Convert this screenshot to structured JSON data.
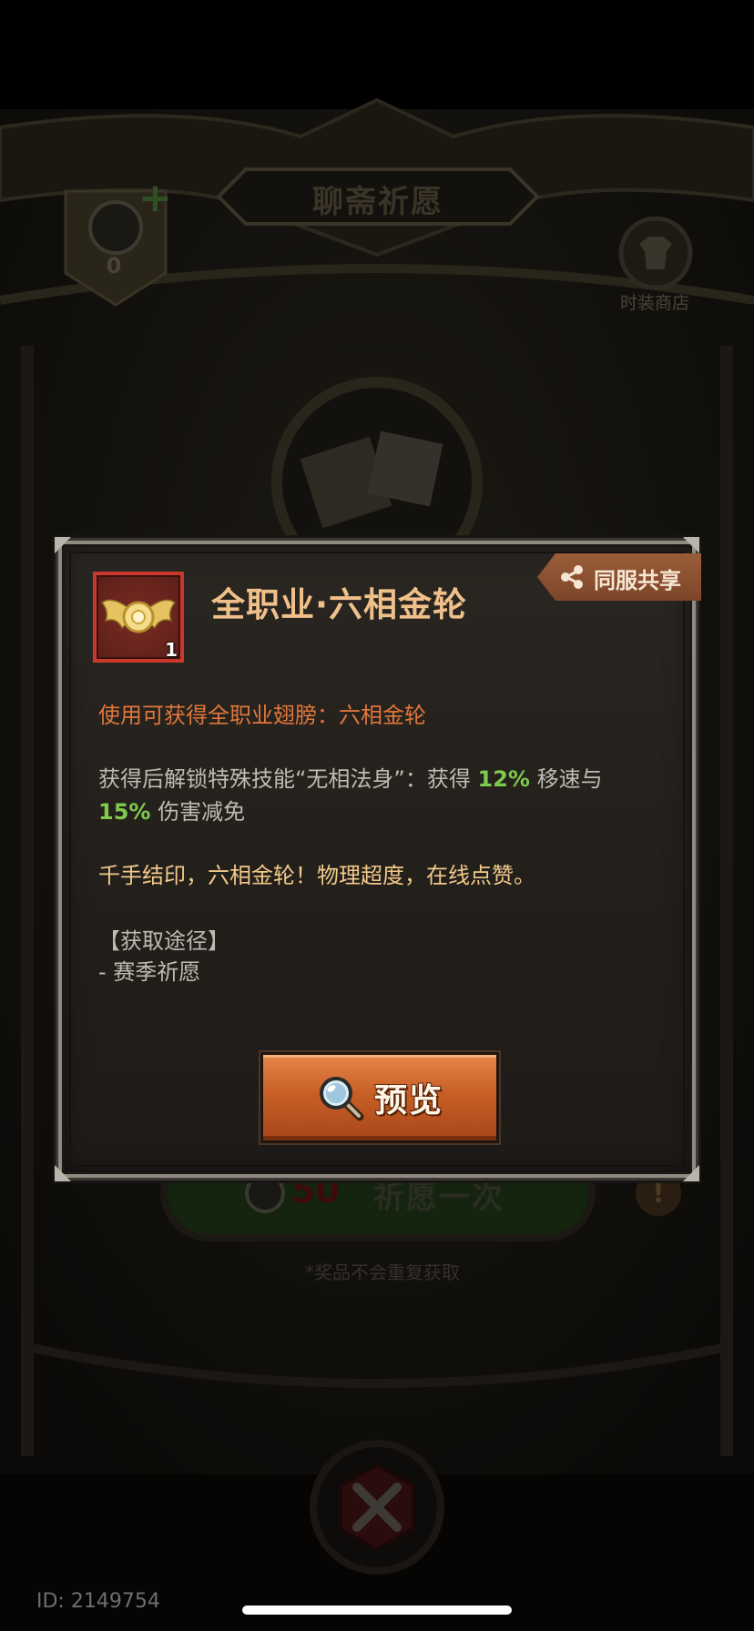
{
  "background": {
    "title": "聊斋祈愿",
    "currency_count": "0",
    "shop_label": "时装商店",
    "pray_cost": "50",
    "pray_label": "祈愿一次",
    "note": "*奖品不会重复获取",
    "player_id": "ID: 2149754"
  },
  "modal": {
    "item_name": "全职业·六相金轮",
    "item_count": "1",
    "share_label": "同服共享",
    "usage_text": "使用可获得全职业翅膀：六相金轮",
    "skill": {
      "prefix": "获得后解锁特殊技能“无相法身”：获得 ",
      "speed_value": "12%",
      "speed_text": " 移速与",
      "reduction_value": "15%",
      "reduction_text": " 伤害减免"
    },
    "flavor_text": "千手结印，六相金轮！物理超度，在线点赞。",
    "source_title": "【获取途径】",
    "source_item": "- 赛季祈愿",
    "preview_label": "预览"
  },
  "colors": {
    "title_gold": "#f0c08a",
    "usage_orange": "#e0763c",
    "highlight_green": "#7fc94c",
    "flavor_gold": "#f2c98a",
    "body_grey": "#bfbab2",
    "button_orange": "#c85f26"
  },
  "icons": {
    "share": "share-nodes-icon",
    "preview": "magnifier-icon",
    "item": "golden-wheel-wings-icon"
  }
}
